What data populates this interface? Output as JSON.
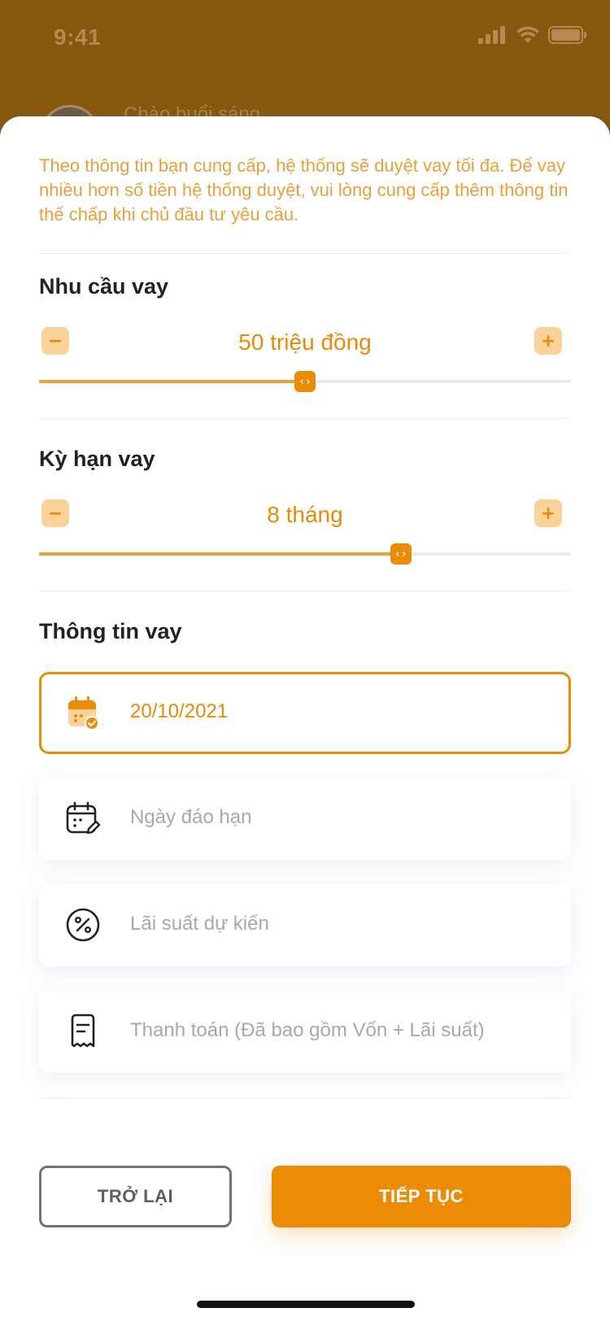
{
  "status_bar": {
    "time": "9:41"
  },
  "background": {
    "greeting": "Chào buổi sáng"
  },
  "notice": "Theo thông tin bạn cung cấp, hệ thống sẽ duyệt vay tối đa. Để vay nhiều hơn số tiền hệ thống duyệt, vui lòng cung cấp thêm thông tin thế chấp khi chủ đầu tư yêu cầu.",
  "loan_amount": {
    "title": "Nhu cầu vay",
    "value": "50 triệu đồng",
    "slider_fraction": 0.5
  },
  "loan_term": {
    "title": "Kỳ hạn vay",
    "value": "8 tháng",
    "slider_fraction": 0.68
  },
  "loan_info": {
    "title": "Thông tin vay",
    "start_date": "20/10/2021",
    "due_date_placeholder": "Ngày đáo hạn",
    "interest_placeholder": "Lãi suất dự kiến",
    "payment_placeholder": "Thanh toán (Đã bao gồm Vốn + Lãi suất)"
  },
  "actions": {
    "back": "TRỞ LẠI",
    "next": "TIẾP TỤC"
  },
  "colors": {
    "accent": "#EA8C08",
    "accent_light": "#FBD29A",
    "overlay": "#86570F"
  }
}
